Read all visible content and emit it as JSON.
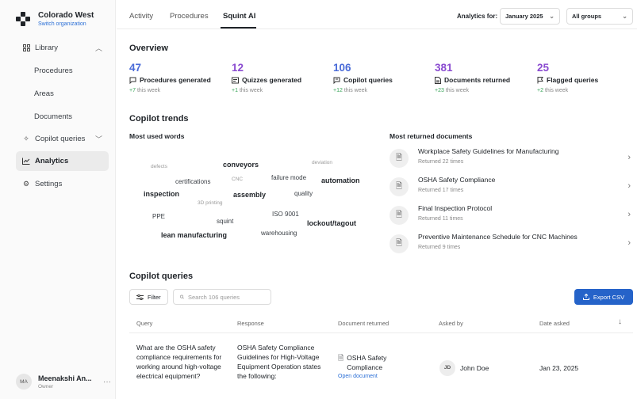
{
  "org": {
    "name": "Colorado West",
    "switch_label": "Switch organization"
  },
  "sidebar": {
    "items": [
      {
        "label": "Library",
        "icon": "grid-icon"
      },
      {
        "label": "Procedures"
      },
      {
        "label": "Areas"
      },
      {
        "label": "Documents"
      },
      {
        "label": "Copilot queries",
        "icon": "sparkle-icon"
      },
      {
        "label": "Analytics",
        "icon": "trend-icon",
        "active": true
      },
      {
        "label": "Settings",
        "icon": "gear-icon"
      }
    ]
  },
  "user": {
    "initials": "MA",
    "name": "Meenakshi An...",
    "role": "Owner"
  },
  "tabs": [
    "Activity",
    "Procedures",
    "Squint AI"
  ],
  "filters": {
    "label": "Analytics for:",
    "period": "January 2025",
    "groups": "All groups"
  },
  "overview": {
    "title": "Overview",
    "stats": [
      {
        "value": "47",
        "label": "Procedures generated",
        "delta": "+7",
        "suffix": "this week",
        "color": "#4a6bd8",
        "icon": "chat-icon"
      },
      {
        "value": "12",
        "label": "Quizzes generated",
        "delta": "+1",
        "suffix": "this week",
        "color": "#8a4bd0",
        "icon": "quiz-icon"
      },
      {
        "value": "106",
        "label": "Copilot queries",
        "delta": "+12",
        "suffix": "this week",
        "color": "#4a6bd8",
        "icon": "query-icon"
      },
      {
        "value": "381",
        "label": "Documents returned",
        "delta": "+23",
        "suffix": "this week",
        "color": "#8a4bd0",
        "icon": "document-icon"
      },
      {
        "value": "25",
        "label": "Flagged queries",
        "delta": "+2",
        "suffix": "this week",
        "color": "#8a4bd0",
        "icon": "flag-icon"
      }
    ]
  },
  "trends": {
    "title": "Copilot trends",
    "words_title": "Most used words",
    "words": [
      {
        "text": "defects",
        "weight": 1
      },
      {
        "text": "conveyors",
        "weight": 3
      },
      {
        "text": "deviation",
        "weight": 1
      },
      {
        "text": "certifications",
        "weight": 2
      },
      {
        "text": "CNC",
        "weight": 1
      },
      {
        "text": "failure mode",
        "weight": 2
      },
      {
        "text": "automation",
        "weight": 3
      },
      {
        "text": "inspection",
        "weight": 3
      },
      {
        "text": "assembly",
        "weight": 3
      },
      {
        "text": "quality",
        "weight": 2
      },
      {
        "text": "3D printing",
        "weight": 1
      },
      {
        "text": "PPE",
        "weight": 2
      },
      {
        "text": "squint",
        "weight": 2
      },
      {
        "text": "ISO 9001",
        "weight": 2
      },
      {
        "text": "lockout/tagout",
        "weight": 3
      },
      {
        "text": "lean manufacturing",
        "weight": 3
      },
      {
        "text": "warehousing",
        "weight": 2
      }
    ],
    "docs_title": "Most returned documents",
    "docs": [
      {
        "title": "Workplace Safety Guidelines for Manufacturing",
        "returned": "Returned 22 times"
      },
      {
        "title": "OSHA Safety Compliance",
        "returned": "Returned 17 times"
      },
      {
        "title": "Final Inspection Protocol",
        "returned": "Returned 11 times"
      },
      {
        "title": "Preventive Maintenance Schedule for CNC Machines",
        "returned": "Returned 9 times"
      }
    ]
  },
  "queries": {
    "title": "Copilot queries",
    "filter_label": "Filter",
    "search_placeholder": "Search 106 queries",
    "export_label": "Export CSV",
    "columns": [
      "Query",
      "Response",
      "Document returned",
      "Asked by",
      "Date asked"
    ],
    "rows": [
      {
        "query": "What are the OSHA safety compliance requirements for working around high-voltage electrical equipment?",
        "response": "OSHA Safety Compliance Guidelines for High-Voltage Equipment Operation states the following:",
        "document": "OSHA Safety Compliance",
        "open_label": "Open document",
        "asked_by_initials": "JD",
        "asked_by": "John Doe",
        "date": "Jan 23, 2025"
      }
    ]
  },
  "colors": {
    "accent": "#2563c9",
    "positive": "#3aa55a"
  }
}
